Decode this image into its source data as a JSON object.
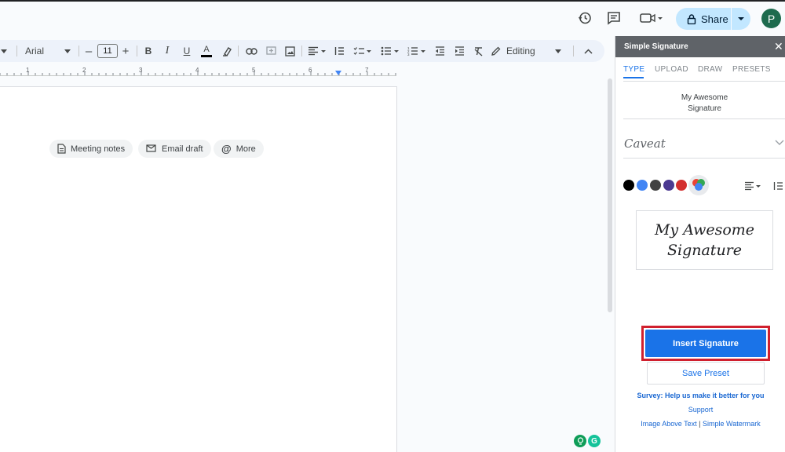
{
  "header": {
    "share_label": "Share",
    "avatar_initial": "P"
  },
  "toolbar": {
    "font_name": "Arial",
    "font_size": "11",
    "mode_label": "Editing"
  },
  "ruler": {
    "numbers": [
      "1",
      "2",
      "3",
      "4",
      "5",
      "6",
      "7"
    ]
  },
  "doc": {
    "chips": [
      "Meeting notes",
      "Email draft",
      "More"
    ]
  },
  "panel": {
    "title": "Simple Signature",
    "tabs": [
      "TYPE",
      "UPLOAD",
      "DRAW",
      "PRESETS"
    ],
    "signature_line1": "My Awesome",
    "signature_line2": "Signature",
    "font_selected": "Caveat",
    "colors": [
      "#000000",
      "#4285f4",
      "#424242",
      "#4c3a91",
      "#d32f2f"
    ],
    "preview_line1": "My Awesome",
    "preview_line2": "Signature",
    "insert_label": "Insert Signature",
    "save_preset_label": "Save Preset",
    "survey_label": "Survey: Help us make it better for you",
    "support_label": "Support",
    "link_image_above": "Image Above Text",
    "link_separator": "|",
    "link_watermark": "Simple Watermark"
  }
}
